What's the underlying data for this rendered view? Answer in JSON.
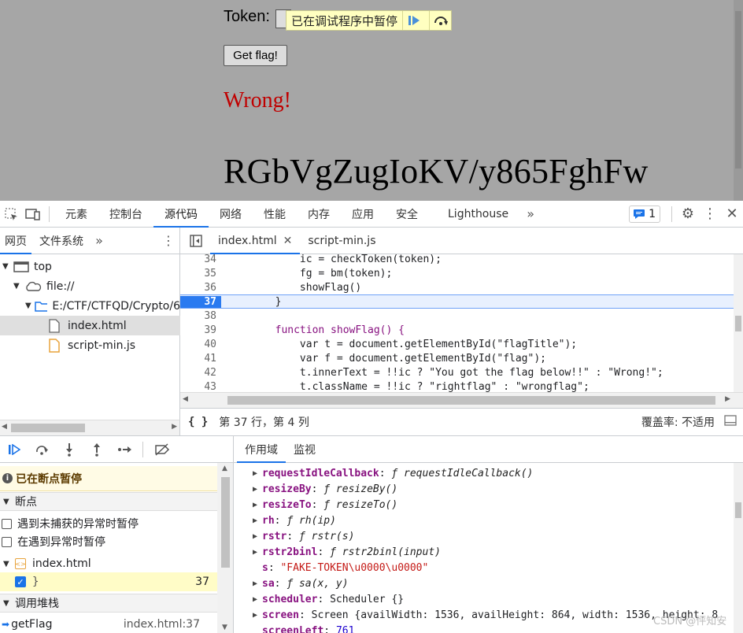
{
  "page": {
    "token_label": "Token:",
    "token_value": "F",
    "paused_banner": "已在调试程序中暂停",
    "get_flag_button": "Get flag!",
    "result_text": "Wrong!",
    "flag_text": "RGbVgZugIoKV/y865FghFw"
  },
  "devtools": {
    "tabs": [
      "元素",
      "控制台",
      "源代码",
      "网络",
      "性能",
      "内存",
      "应用",
      "安全",
      "Lighthouse"
    ],
    "active_tab": "源代码",
    "issues_count": "1"
  },
  "navigator": {
    "tabs": [
      "网页",
      "文件系统"
    ],
    "tree": {
      "top": "top",
      "origin": "file://",
      "folder": "E:/CTF/CTFQD/Crypto/6",
      "file1": "index.html",
      "file2": "script-min.js"
    }
  },
  "editor": {
    "tabs": [
      "index.html",
      "script-min.js"
    ],
    "lines": [
      {
        "num": "34",
        "text": "            ic = checkToken(token);"
      },
      {
        "num": "35",
        "text": "            fg = bm(token);"
      },
      {
        "num": "36",
        "text": "            showFlag()"
      },
      {
        "num": "37",
        "text": "        }"
      },
      {
        "num": "38",
        "text": ""
      },
      {
        "num": "39",
        "text": "        function showFlag() {"
      },
      {
        "num": "40",
        "text": "            var t = document.getElementById(\"flagTitle\");"
      },
      {
        "num": "41",
        "text": "            var f = document.getElementById(\"flag\");"
      },
      {
        "num": "42",
        "text": "            t.innerText = !!ic ? \"You got the flag below!!\" : \"Wrong!\";"
      },
      {
        "num": "43",
        "text": "            t.className = !!ic ? \"rightflag\" : \"wrongflag\";"
      }
    ],
    "status_position": "第 37 行，第 4 列",
    "coverage": "覆盖率: 不适用"
  },
  "debugger": {
    "paused_text": "已在断点暂停",
    "breakpoints_header": "断点",
    "pause_uncaught": "遇到未捕获的异常时暂停",
    "pause_caught": "在遇到异常时暂停",
    "bp_file": "index.html",
    "bp_code": "}",
    "bp_line": "37",
    "callstack_header": "调用堆栈",
    "callstack_fn": "getFlag",
    "callstack_loc": "index.html:37"
  },
  "scope": {
    "tabs": [
      "作用域",
      "监视"
    ],
    "rows": [
      {
        "name": "requestIdleCallback",
        "value": "ƒ requestIdleCallback()"
      },
      {
        "name": "resizeBy",
        "value": "ƒ resizeBy()"
      },
      {
        "name": "resizeTo",
        "value": "ƒ resizeTo()"
      },
      {
        "name": "rh",
        "value": "ƒ rh(ip)"
      },
      {
        "name": "rstr",
        "value": "ƒ rstr(s)"
      },
      {
        "name": "rstr2binl",
        "value": "ƒ rstr2binl(input)"
      },
      {
        "name": "s",
        "value": "\"FAKE-TOKEN\\u0000\\u0000\""
      },
      {
        "name": "sa",
        "value": "ƒ sa(x, y)"
      },
      {
        "name": "scheduler",
        "value": "Scheduler {}"
      },
      {
        "name": "screen",
        "value": "Screen {availWidth: 1536, availHeight: 864, width: 1536, height: 8"
      },
      {
        "name": "screenLeft",
        "value": "761"
      }
    ]
  },
  "watermark": "CSDN @怦知安"
}
